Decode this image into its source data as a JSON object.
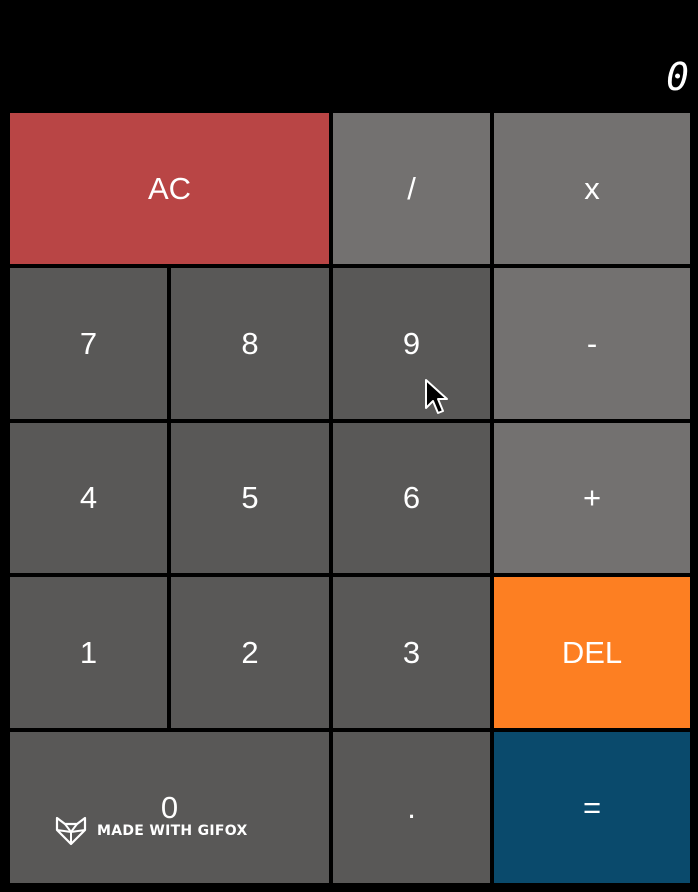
{
  "display": {
    "value": "0"
  },
  "keys": {
    "clear": "AC",
    "divide": "/",
    "multiply": "x",
    "seven": "7",
    "eight": "8",
    "nine": "9",
    "minus": "-",
    "four": "4",
    "five": "5",
    "six": "6",
    "plus": "+",
    "one": "1",
    "two": "2",
    "three": "3",
    "delete": "DEL",
    "zero": "0",
    "decimal": ".",
    "equals": "="
  },
  "watermark": {
    "text": "MADE WITH GIFOX",
    "icon": "fox-logo-icon"
  },
  "colors": {
    "digit_key": "#595857",
    "operator_key": "#737170",
    "clear_key": "#b94545",
    "delete_key": "#fd7f22",
    "equals_key": "#0a4a6c",
    "background": "#000000"
  },
  "icons": {
    "pointer": "mouse-pointer-icon"
  }
}
